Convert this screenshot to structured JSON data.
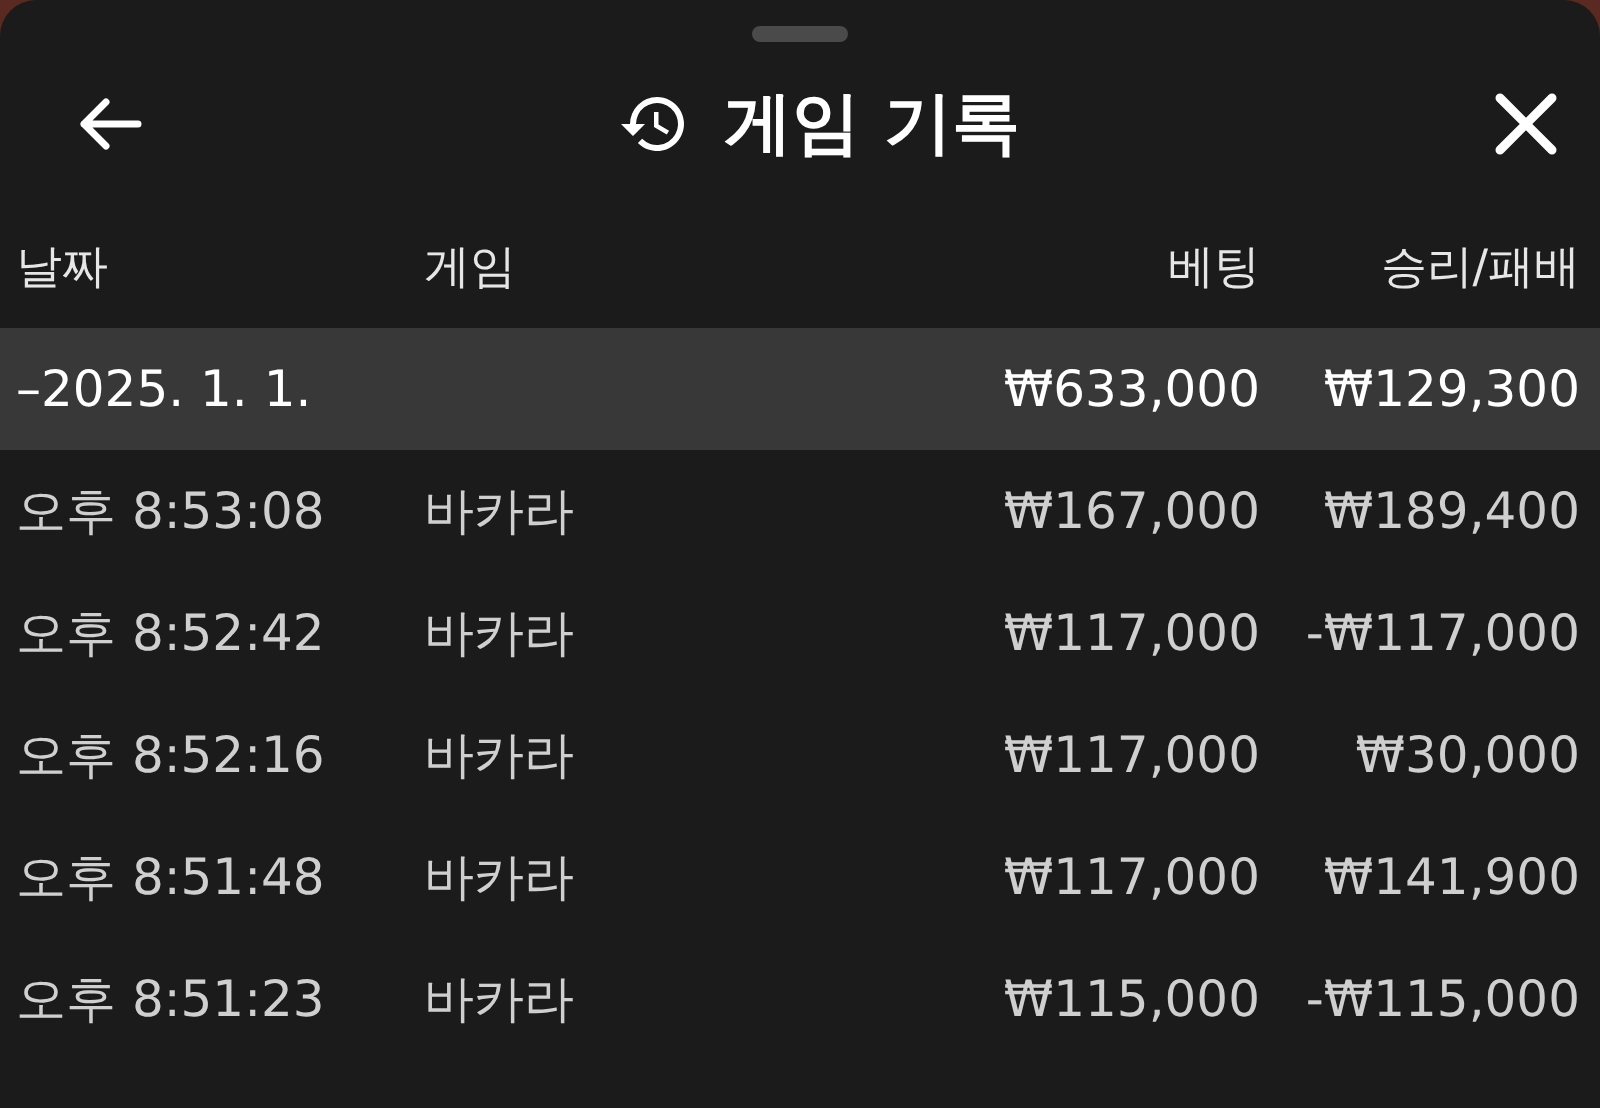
{
  "header": {
    "title": "게임 기록"
  },
  "columns": [
    "날짜",
    "게임",
    "베팅",
    "승리/패배"
  ],
  "group": {
    "label": "–2025. 1. 1.",
    "bet": "₩633,000",
    "result": "₩129,300",
    "expanded": true
  },
  "rows": [
    {
      "time": "오후 8:53:08",
      "game": "바카라",
      "bet": "₩167,000",
      "result": "₩189,400"
    },
    {
      "time": "오후 8:52:42",
      "game": "바카라",
      "bet": "₩117,000",
      "result": "-₩117,000"
    },
    {
      "time": "오후 8:52:16",
      "game": "바카라",
      "bet": "₩117,000",
      "result": "₩30,000"
    },
    {
      "time": "오후 8:51:48",
      "game": "바카라",
      "bet": "₩117,000",
      "result": "₩141,900"
    },
    {
      "time": "오후 8:51:23",
      "game": "바카라",
      "bet": "₩115,000",
      "result": "-₩115,000"
    }
  ]
}
